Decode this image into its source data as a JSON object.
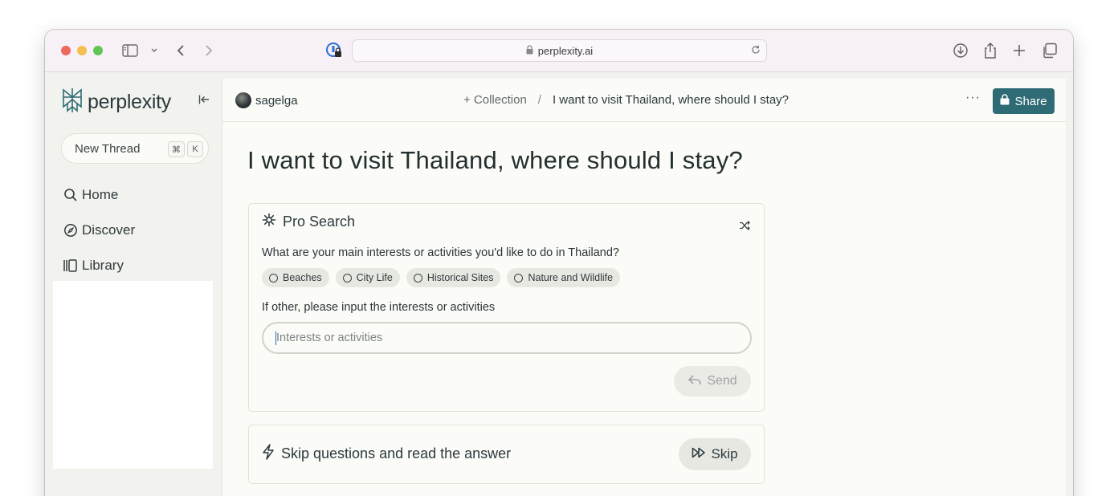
{
  "browser": {
    "url": "perplexity.ai"
  },
  "sidebar": {
    "brand": "perplexity",
    "new_thread_label": "New Thread",
    "shortcut_keys": [
      "⌘",
      "K"
    ],
    "items": [
      {
        "label": "Home",
        "icon": "search-icon"
      },
      {
        "label": "Discover",
        "icon": "compass-icon"
      },
      {
        "label": "Library",
        "icon": "library-icon"
      }
    ]
  },
  "header": {
    "username": "sagelga",
    "collection_label": "+ Collection",
    "separator": "/",
    "thread_title": "I want to visit Thailand, where should I stay?",
    "more_label": "···",
    "share_label": "Share"
  },
  "main": {
    "title": "I want to visit Thailand, where should I stay?",
    "pro_search": {
      "heading": "Pro Search",
      "question1": "What are your main interests or activities you'd like to do in Thailand?",
      "options": [
        "Beaches",
        "City Life",
        "Historical Sites",
        "Nature and Wildlife"
      ],
      "question2": "If other, please input the interests or activities",
      "input_placeholder": "Interests or activities",
      "input_value": "",
      "send_label": "Send"
    },
    "skip_card": {
      "heading": "Skip questions and read the answer",
      "skip_label": "Skip"
    }
  },
  "colors": {
    "accent": "#2e6b75",
    "window_bg": "#f2f2ee",
    "content_bg": "#fbfbf8"
  }
}
